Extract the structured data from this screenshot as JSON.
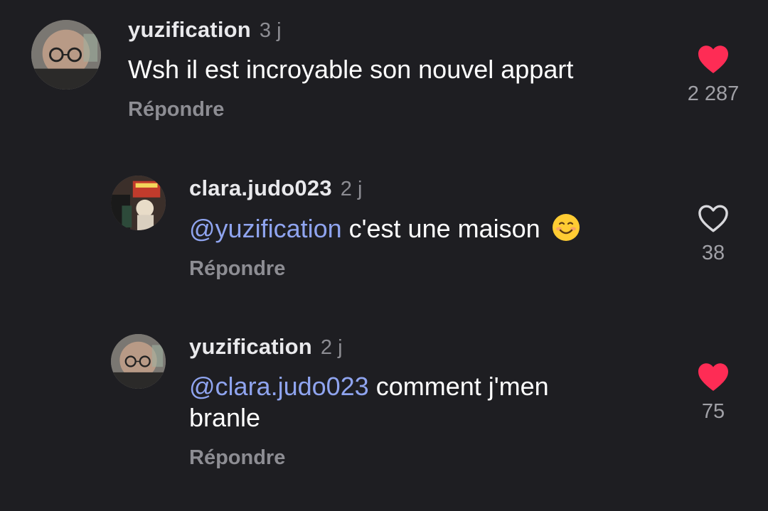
{
  "colors": {
    "background": "#1e1e22",
    "mention": "#8fa4ef",
    "heart_liked": "#fe2c55",
    "muted": "#8d8d93"
  },
  "comments": [
    {
      "username": "yuzification",
      "time": "3 j",
      "mention": "",
      "text": "Wsh il est incroyable son nouvel appart",
      "text_line2": "",
      "reply_label": "Répondre",
      "likes": "2 287",
      "liked": true,
      "avatar": "avatar-photo-glasses"
    },
    {
      "username": "clara.judo023",
      "time": "2 j",
      "mention": "@yuzification",
      "text": " c'est une maison",
      "emoji": "smiling-face-emoji",
      "reply_label": "Répondre",
      "likes": "38",
      "liked": false,
      "avatar": "avatar-photo-shop"
    },
    {
      "username": "yuzification",
      "time": "2 j",
      "mention": "@clara.judo023",
      "text": " comment j'men",
      "text_line2": "branle",
      "reply_label": "Répondre",
      "likes": "75",
      "liked": true,
      "avatar": "avatar-photo-glasses"
    }
  ]
}
